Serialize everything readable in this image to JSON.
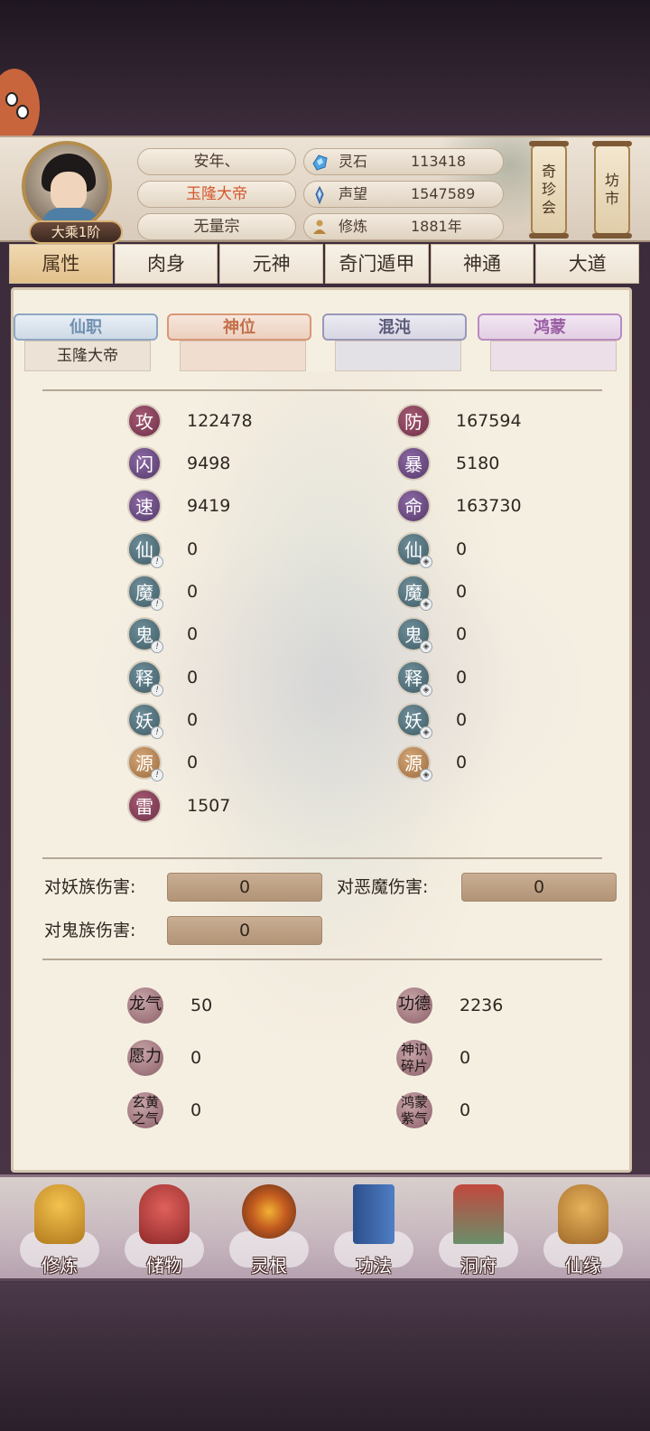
{
  "header": {
    "rank_badge": "大乘1阶",
    "player_name": "安年、",
    "title": "玉隆大帝",
    "sect": "无量宗",
    "resources": [
      {
        "label": "灵石",
        "value": "113418",
        "icon": "spirit-stone-icon"
      },
      {
        "label": "声望",
        "value": "1547589",
        "icon": "reputation-icon"
      },
      {
        "label": "修炼",
        "value": "1881年",
        "icon": "meditation-icon"
      }
    ],
    "buttons": {
      "treasure_hall": [
        "奇",
        "珍",
        "会"
      ],
      "market": [
        "坊",
        "市"
      ]
    }
  },
  "tabs": [
    "属性",
    "肉身",
    "元神",
    "奇门遁甲",
    "神通",
    "大道"
  ],
  "active_tab": "属性",
  "ranks": [
    {
      "label": "仙职",
      "value": "玉隆大帝",
      "color": "#6f8fb0"
    },
    {
      "label": "神位",
      "value": "",
      "color": "#c4704a"
    },
    {
      "label": "混沌",
      "value": "",
      "color": "#5b5b7a"
    },
    {
      "label": "鸿蒙",
      "value": "",
      "color": "#9a5da3"
    }
  ],
  "stats_left": [
    {
      "name": "攻",
      "value": "122478"
    },
    {
      "name": "闪",
      "value": "9498"
    },
    {
      "name": "速",
      "value": "9419"
    },
    {
      "name": "仙",
      "value": "0"
    },
    {
      "name": "魔",
      "value": "0"
    },
    {
      "name": "鬼",
      "value": "0"
    },
    {
      "name": "释",
      "value": "0"
    },
    {
      "name": "妖",
      "value": "0"
    },
    {
      "name": "源",
      "value": "0"
    },
    {
      "name": "雷",
      "value": "1507"
    }
  ],
  "stats_right": [
    {
      "name": "防",
      "value": "167594"
    },
    {
      "name": "暴",
      "value": "5180"
    },
    {
      "name": "命",
      "value": "163730"
    },
    {
      "name": "仙",
      "value": "0"
    },
    {
      "name": "魔",
      "value": "0"
    },
    {
      "name": "鬼",
      "value": "0"
    },
    {
      "name": "释",
      "value": "0"
    },
    {
      "name": "妖",
      "value": "0"
    },
    {
      "name": "源",
      "value": "0"
    }
  ],
  "damage": {
    "demon_race_label": "对妖族伤害:",
    "demon_race_value": "0",
    "evil_demon_label": "对恶魔伤害:",
    "evil_demon_value": "0",
    "ghost_race_label": "对鬼族伤害:",
    "ghost_race_value": "0"
  },
  "extras": [
    {
      "name": "龙气",
      "value": "50"
    },
    {
      "name": "功德",
      "value": "2236"
    },
    {
      "name": "愿力",
      "value": "0"
    },
    {
      "name": "神识碎片",
      "value": "0"
    },
    {
      "name": "玄黄之气",
      "value": "0"
    },
    {
      "name": "鸿蒙紫气",
      "value": "0"
    }
  ],
  "nav": [
    "修炼",
    "储物",
    "灵根",
    "功法",
    "洞府",
    "仙缘"
  ]
}
